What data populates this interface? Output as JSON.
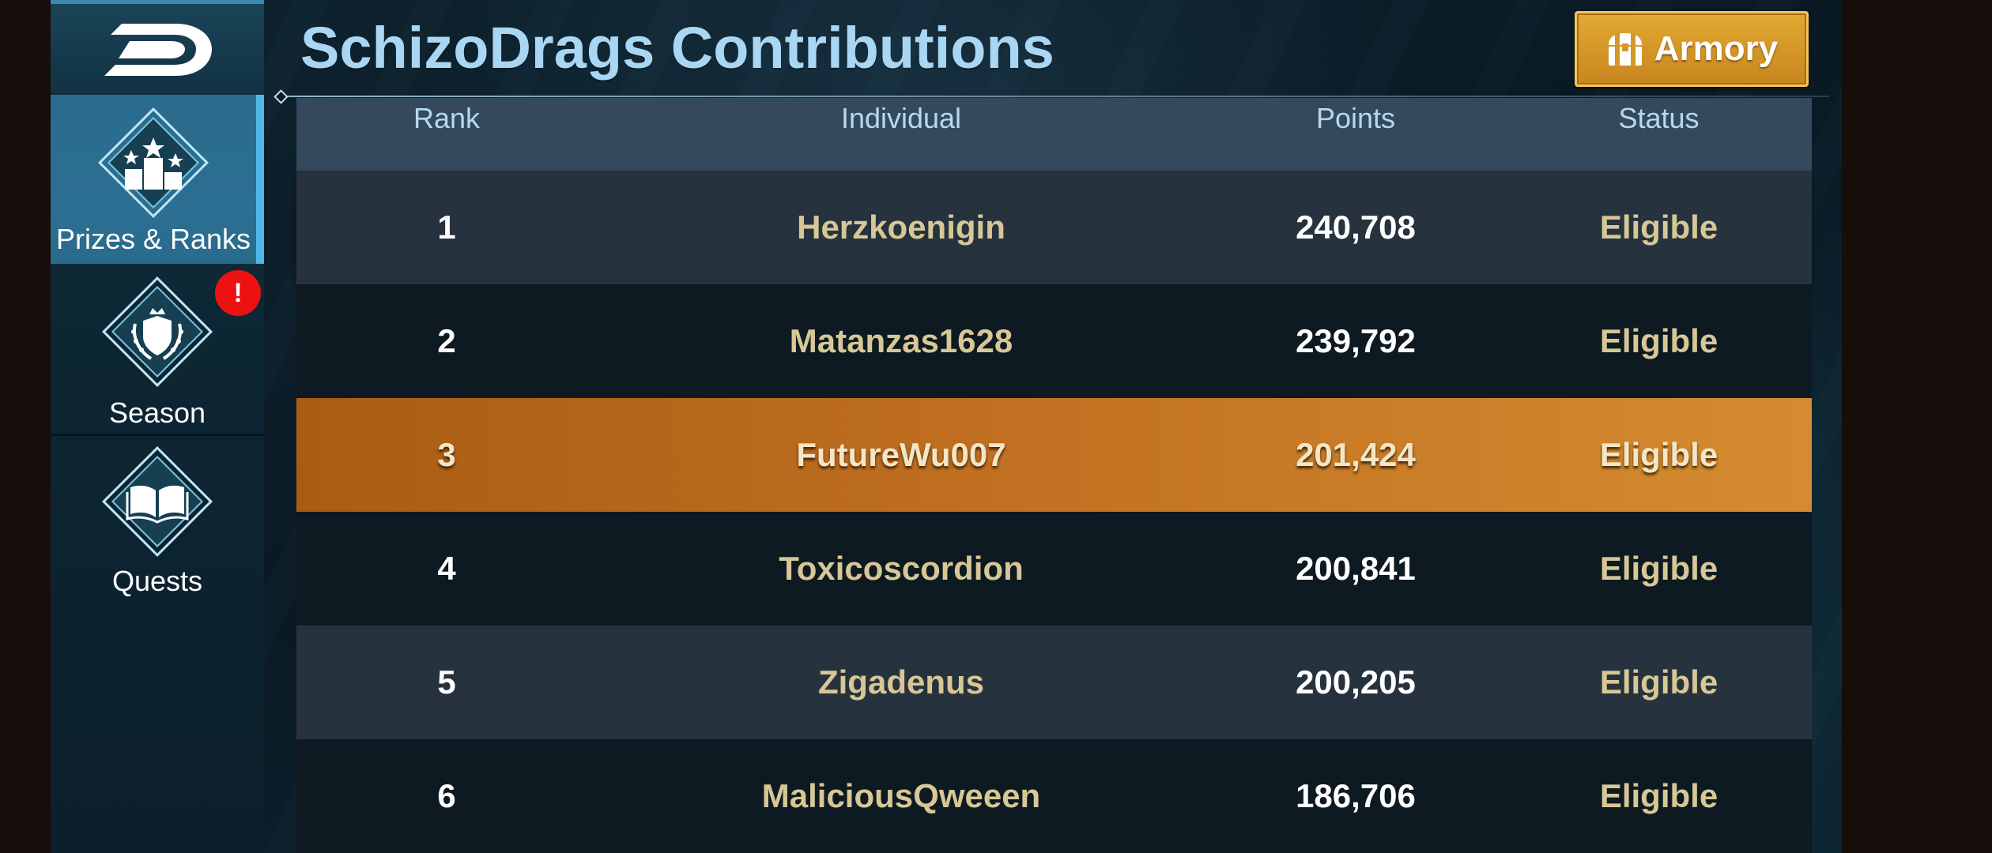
{
  "header": {
    "title": "SchizoDrags Contributions",
    "armory_label": "Armory"
  },
  "sidebar": {
    "back_icon": "dragon-d-logo-icon",
    "items": [
      {
        "label": "Prizes & Ranks",
        "icon": "podium-stars-icon",
        "active": true
      },
      {
        "label": "Season",
        "icon": "laurel-crest-icon",
        "badge": "!"
      },
      {
        "label": "Quests",
        "icon": "open-book-icon"
      }
    ]
  },
  "table": {
    "columns": [
      "Rank",
      "Individual",
      "Points",
      "Status"
    ],
    "rows": [
      {
        "rank": "1",
        "name": "Herzkoenigin",
        "points": "240,708",
        "status": "Eligible"
      },
      {
        "rank": "2",
        "name": "Matanzas1628",
        "points": "239,792",
        "status": "Eligible"
      },
      {
        "rank": "3",
        "name": "FutureWu007",
        "points": "201,424",
        "status": "Eligible",
        "highlighted": true
      },
      {
        "rank": "4",
        "name": "Toxicoscordion",
        "points": "200,841",
        "status": "Eligible"
      },
      {
        "rank": "5",
        "name": "Zigadenus",
        "points": "200,205",
        "status": "Eligible"
      },
      {
        "rank": "6",
        "name": "MaliciousQweeen",
        "points": "186,706",
        "status": "Eligible"
      }
    ]
  },
  "colors": {
    "title": "#a9d6f2",
    "name_text": "#d8c796",
    "highlight_row": "#c06f20",
    "armory_button": "#d59728",
    "badge": "#ee1111"
  }
}
